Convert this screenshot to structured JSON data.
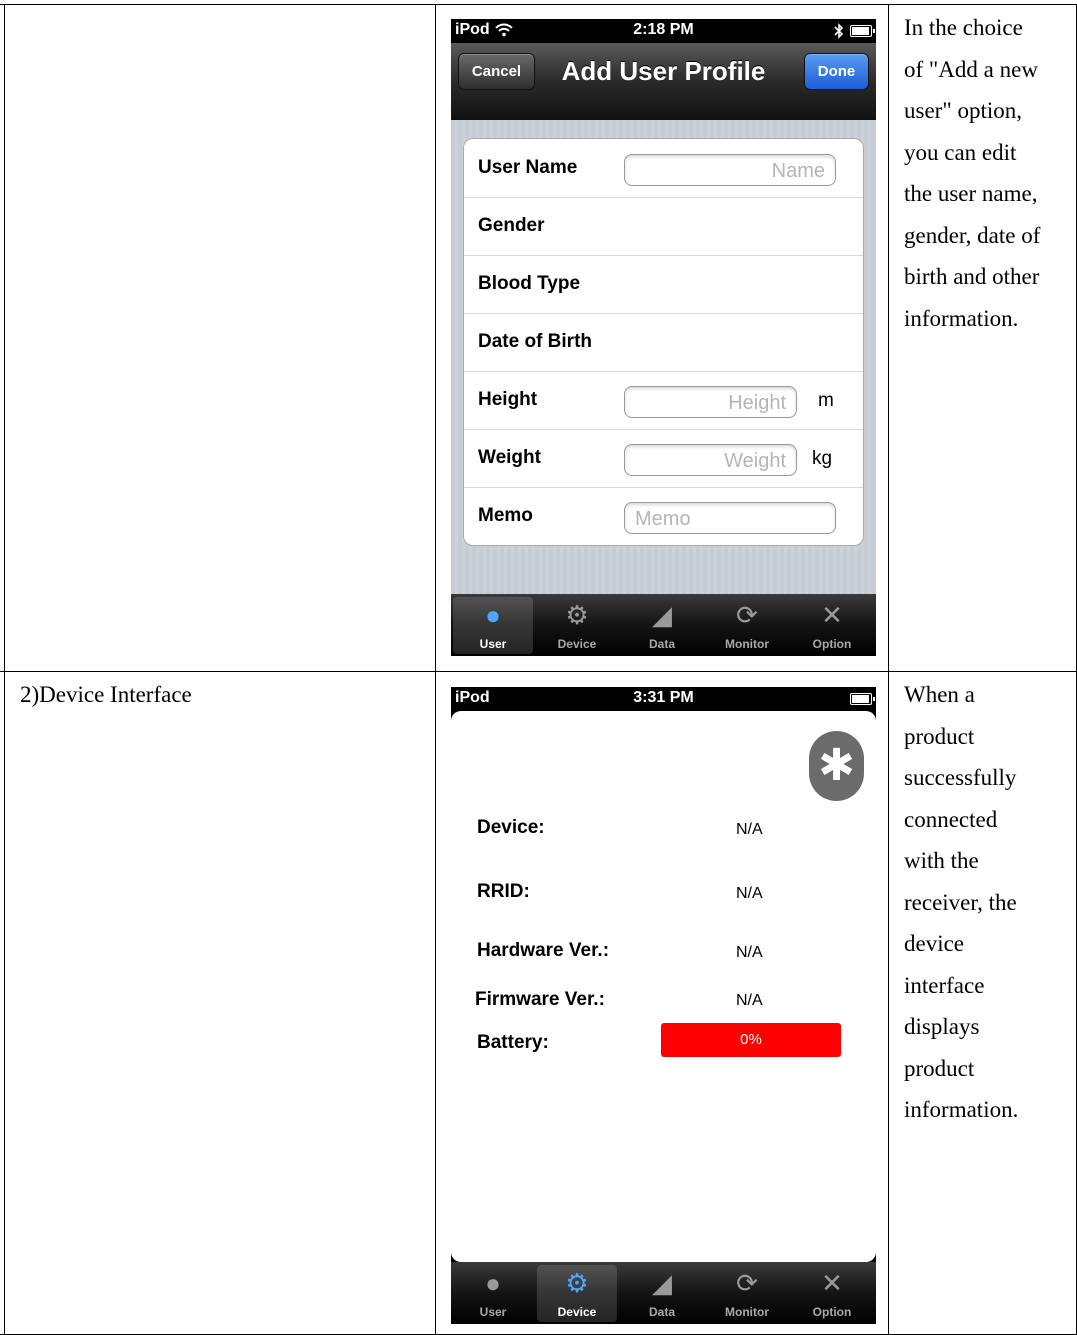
{
  "row1": {
    "left_text": "",
    "description": [
      "In the choice",
      "of \"Add a new",
      "user\" option,",
      "you can edit",
      "the user name,",
      "gender, date of",
      "birth and other",
      "information."
    ]
  },
  "row2": {
    "left_text": "2)Device Interface",
    "description": [
      "When a",
      "product",
      "successfully",
      "connected",
      "with the",
      "receiver, the",
      "device",
      "interface",
      "displays",
      "product",
      "information."
    ]
  },
  "phone1": {
    "status": {
      "carrier": "iPod",
      "time": "2:18 PM"
    },
    "nav": {
      "title": "Add User Profile",
      "cancel": "Cancel",
      "done": "Done"
    },
    "form": [
      {
        "label": "User Name",
        "placeholder": "Name",
        "unit": ""
      },
      {
        "label": "Gender"
      },
      {
        "label": "Blood Type"
      },
      {
        "label": "Date of Birth"
      },
      {
        "label": "Height",
        "placeholder": "Height",
        "unit": "m"
      },
      {
        "label": "Weight",
        "placeholder": "Weight",
        "unit": "kg"
      },
      {
        "label": "Memo",
        "placeholder": "Memo"
      }
    ],
    "tabs": [
      "User",
      "Device",
      "Data",
      "Monitor",
      "Option"
    ],
    "active_tab": "User"
  },
  "phone2": {
    "status": {
      "carrier": "iPod",
      "time": "3:31 PM"
    },
    "info": [
      {
        "label": "Device:",
        "value": "N/A"
      },
      {
        "label": "RRID:",
        "value": "N/A"
      },
      {
        "label": "Hardware Ver.:",
        "value": "N/A"
      },
      {
        "label": "Firmware Ver.:",
        "value": "N/A"
      }
    ],
    "battery": {
      "label": "Battery:",
      "value": "0%",
      "level": 0,
      "color": "#ff0000"
    },
    "tabs": [
      "User",
      "Device",
      "Data",
      "Monitor",
      "Option"
    ],
    "active_tab": "Device"
  },
  "icons": {
    "wifi": "wifi-icon",
    "bluetooth": "bluetooth-icon",
    "battery": "battery-icon"
  }
}
